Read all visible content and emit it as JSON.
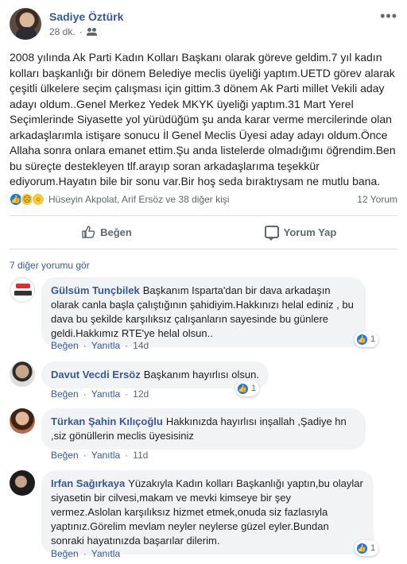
{
  "post": {
    "author": "Sadiye Öztürk",
    "time": "28 dk.",
    "audience_icon": "friends-icon",
    "text": "2008 yılında Ak Parti Kadın Kolları Başkanı olarak göreve geldim.7 yıl kadın kolları başkanlığı bir dönem Belediye meclis üyeliği yaptım.UETD görev alarak çeşitli ülkelere seçim çalışması için gittim.3 dönem Ak Parti millet Vekili aday adayı oldum..Genel Merkez Yedek MKYK üyeliği yaptım.31 Mart Yerel Seçimlerinde Siyasette yol yürüdüğüm şu anda karar verme mercilerinde olan arkadaşlarımla istişare sonucu İl Genel Meclis Üyesi aday adayı oldum.Önce Allaha sonra onlara emanet ettim.Şu anda listelerde olmadığımı öğrendim.Ben bu süreçte destekleyen tlf.arayıp soran arkadaşlarıma teşekkür ediyorum.Hayatın bile bir sonu var.Bir hoş seda bıraktıysam ne mutlu bana."
  },
  "reactions": {
    "icons": [
      "like",
      "sad",
      "wow"
    ],
    "names": "Hüseyin Akpolat, Arif Ersöz ve 38 diğer kişi",
    "comment_count": "12 Yorum"
  },
  "actions": {
    "like": "Beğen",
    "comment": "Yorum Yap"
  },
  "view_more": "7 diğer yorumu gör",
  "comment_actions": {
    "like": "Beğen",
    "reply": "Yanıtla"
  },
  "comments": [
    {
      "name": "Gülsüm Tunçbilek",
      "text": "Başkanım Isparta'dan bir dava arkadaşın olarak canla başla çalıştığının şahidiyim.Hakkınızı helal ediniz , bu dava bu şekilde karşılıksız çalışanların sayesinde bu günlere geldi.Hakkımız RTE'ye helal olsun..",
      "time": "14d",
      "reaction_count": "1"
    },
    {
      "name": "Davut Vecdi Ersöz",
      "text": "Başkanım hayırlısı olsun.",
      "time": "12d",
      "reaction_count": "1"
    },
    {
      "name": "Türkan Şahin Kılıçoğlu",
      "text": "Hakkınızda hayırlısı inşallah ,Şadiye hn ,siz gönüllerin meclis üyesisiniz",
      "time": "11d",
      "reaction_count": ""
    },
    {
      "name": "Irfan Sağırkaya",
      "text": "Yüzakıyla Kadın kolları Başkanlığı yaptın,bu olaylar siyasetin bir cilvesi,makam ve mevki kimseye bir şey vermez.Aslolan karşılıksız hizmet etmek,onuda siz fazlasıyla yaptınız.Görelim mevlam neyler neylerse güzel eyler.Bundan sonraki hayatınızda başarılar dilerim.",
      "time": "",
      "reaction_count": "1"
    }
  ],
  "colors": {
    "link": "#385898",
    "like_blue": "#1877f2",
    "bubble": "#f2f3f5",
    "muted": "#606770"
  }
}
